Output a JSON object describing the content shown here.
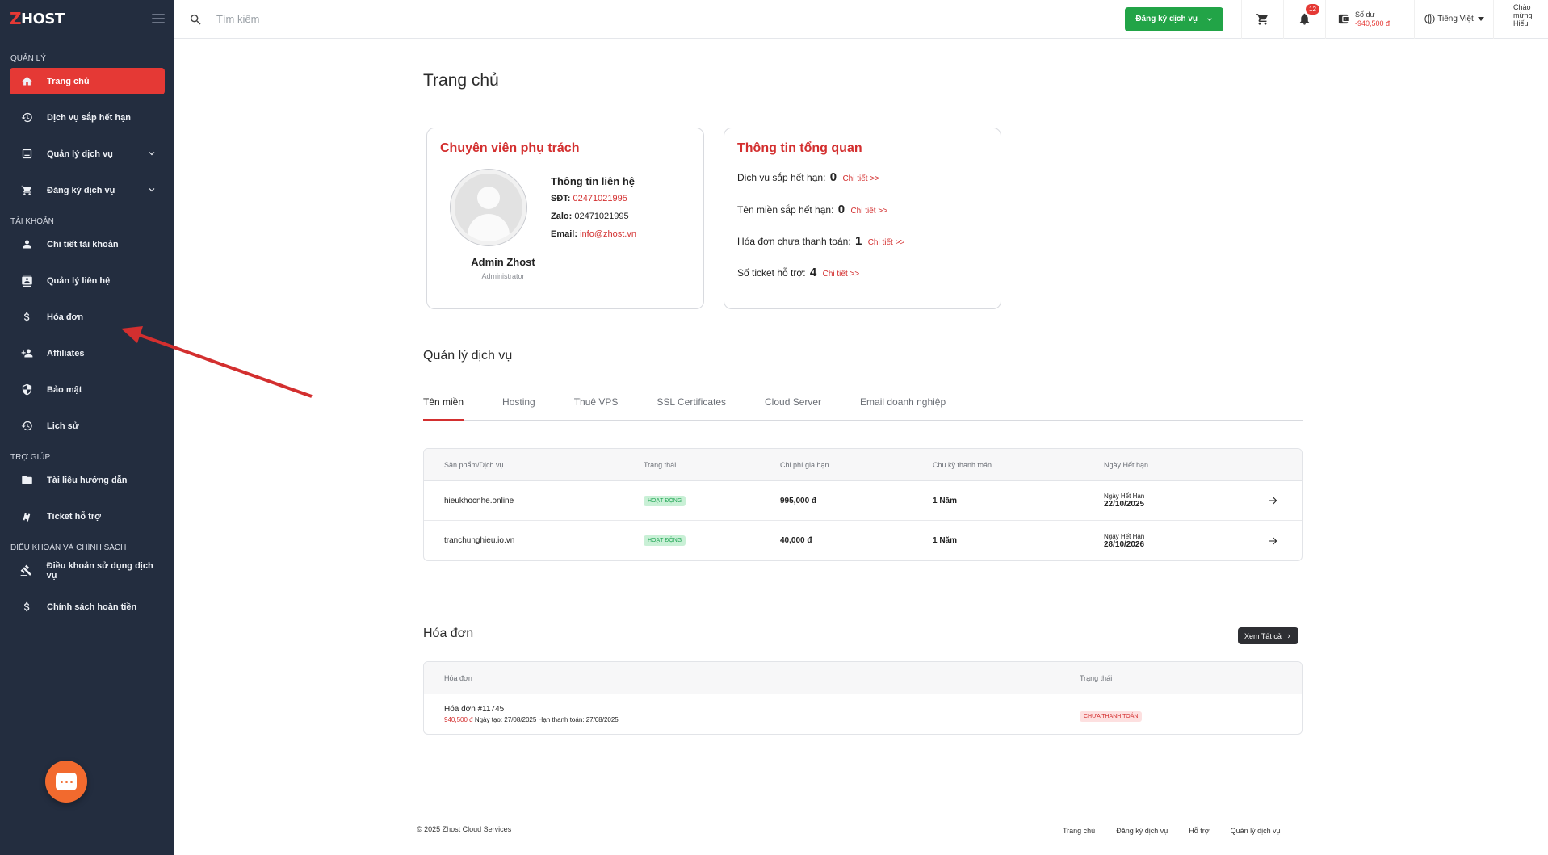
{
  "brand": {
    "logo_mark": "Z",
    "logo_text": "HOST"
  },
  "sidebar": {
    "sections": {
      "manage": "QUẢN LÝ",
      "account": "TÀI KHOẢN",
      "help": "TRỢ GIÚP",
      "terms": "ĐIỀU KHOẢN VÀ CHÍNH SÁCH"
    },
    "items": [
      {
        "label": "Trang chủ",
        "icon": "home-icon",
        "active": true
      },
      {
        "label": "Dịch vụ sắp hết hạn",
        "icon": "history-icon"
      },
      {
        "label": "Quản lý dịch vụ",
        "icon": "box-icon",
        "expandable": true
      },
      {
        "label": "Đăng ký dịch vụ",
        "icon": "cart-icon",
        "expandable": true
      },
      {
        "label": "Chi tiết tài khoản",
        "icon": "user-icon"
      },
      {
        "label": "Quản lý liên hệ",
        "icon": "contacts-icon"
      },
      {
        "label": "Hóa đơn",
        "icon": "dollar-icon"
      },
      {
        "label": "Affiliates",
        "icon": "user-plus-icon"
      },
      {
        "label": "Bảo mật",
        "icon": "shield-icon"
      },
      {
        "label": "Lịch sử",
        "icon": "history-icon"
      },
      {
        "label": "Tài liệu hướng dẫn",
        "icon": "folder-icon"
      },
      {
        "label": "Ticket hỗ trợ",
        "icon": "ticket-icon"
      },
      {
        "label": "Điều khoản sử dụng dịch vụ",
        "icon": "gavel-icon"
      },
      {
        "label": "Chính sách hoàn tiền",
        "icon": "dollar-icon"
      }
    ]
  },
  "topbar": {
    "search_placeholder": "Tìm kiếm",
    "register_button": "Đăng ký dịch vụ",
    "notification_count": "12",
    "balance_label": "Số dư",
    "balance_value": "-940,500 đ",
    "language": "Tiếng Việt",
    "greeting_line1": "Chào",
    "greeting_line2": "mừng",
    "greeting_line3": "Hiếu"
  },
  "page": {
    "title": "Trang chủ"
  },
  "agent_card": {
    "title": "Chuyên viên phụ trách",
    "name": "Admin Zhost",
    "role": "Administrator",
    "contact_title": "Thông tin liên hệ",
    "phone_label": "SĐT:",
    "phone": "02471021995",
    "zalo_label": "Zalo:",
    "zalo": "02471021995",
    "email_label": "Email:",
    "email": "info@zhost.vn"
  },
  "overview_card": {
    "title": "Thông tin tổng quan",
    "items": [
      {
        "label": "Dịch vụ sắp hết hạn:",
        "value": "0",
        "link": "Chi tiết >>"
      },
      {
        "label": "Tên miền sắp hết hạn:",
        "value": "0",
        "link": "Chi tiết >>"
      },
      {
        "label": "Hóa đơn chưa thanh toán:",
        "value": "1",
        "link": "Chi tiết >>"
      },
      {
        "label": "Số ticket hỗ trợ:",
        "value": "4",
        "link": "Chi tiết >>"
      }
    ]
  },
  "services": {
    "title": "Quản lý dịch vụ",
    "tabs": [
      "Tên miền",
      "Hosting",
      "Thuê VPS",
      "SSL Certificates",
      "Cloud Server",
      "Email doanh nghiệp"
    ],
    "active_tab": 0,
    "columns": [
      "Sản phẩm/Dịch vụ",
      "Trạng thái",
      "Chi phí gia hạn",
      "Chu kỳ thanh toán",
      "Ngày Hết hạn"
    ],
    "rows": [
      {
        "product": "hieukhocnhe.online",
        "status": "HOẠT ĐỘNG",
        "price": "995,000 đ",
        "cycle": "1 Năm",
        "expiry_label": "Ngày Hết Hạn",
        "expiry": "22/10/2025"
      },
      {
        "product": "tranchunghieu.io.vn",
        "status": "HOẠT ĐỘNG",
        "price": "40,000 đ",
        "cycle": "1 Năm",
        "expiry_label": "Ngày Hết Hạn",
        "expiry": "28/10/2026"
      }
    ]
  },
  "invoices": {
    "title": "Hóa đơn",
    "view_all": "Xem Tất cả",
    "columns": [
      "Hóa đơn",
      "Trạng thái"
    ],
    "rows": [
      {
        "name": "Hóa đơn #11745",
        "amount": "940,500 đ",
        "meta": "Ngày tạo: 27/08/2025 Hạn thanh toán: 27/08/2025",
        "status": "CHƯA THANH TOÁN"
      }
    ]
  },
  "footer": {
    "copyright": "© 2025 Zhost Cloud Services",
    "links": [
      "Trang chủ",
      "Đăng ký dịch vụ",
      "Hỗ trợ",
      "Quản lý dịch vụ"
    ]
  },
  "colors": {
    "sidebar_bg": "#232d3f",
    "accent_red": "#e53935",
    "green": "#22a447"
  }
}
